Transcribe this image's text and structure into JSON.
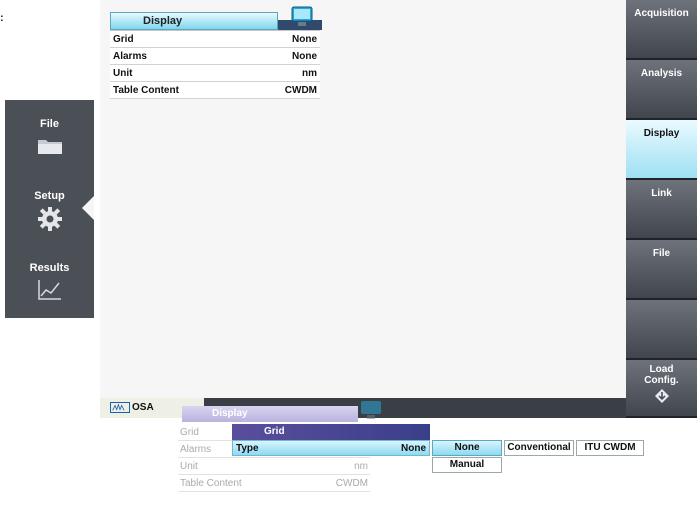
{
  "corner_mark": ":",
  "display_panel": {
    "title": "Display",
    "rows": [
      {
        "label": "Grid",
        "value": "None"
      },
      {
        "label": "Alarms",
        "value": "None"
      },
      {
        "label": "Unit",
        "value": "nm"
      },
      {
        "label": "Table Content",
        "value": "CWDM"
      }
    ]
  },
  "left_menu": {
    "items": [
      {
        "label": "File",
        "icon": "folder-icon"
      },
      {
        "label": "Setup",
        "icon": "gear-icon"
      },
      {
        "label": "Results",
        "icon": "chart-icon"
      }
    ],
    "active": "Setup"
  },
  "softkeys": {
    "items": [
      {
        "label": "Acquisition"
      },
      {
        "label": "Analysis"
      },
      {
        "label": "Display",
        "active": true
      },
      {
        "label": "Link"
      },
      {
        "label": "File"
      },
      {
        "label": ""
      },
      {
        "label": "Load Config.",
        "icon": "load-config-icon"
      }
    ]
  },
  "status_bar": {
    "tab_label": "OSA",
    "tab_icon": "osa-waveform-icon"
  },
  "bottom_snapshot": {
    "title": "Display",
    "rows": [
      {
        "label": "Grid",
        "value": ""
      },
      {
        "label": "Alarms",
        "value": ""
      },
      {
        "label": "Unit",
        "value": "nm"
      },
      {
        "label": "Table Content",
        "value": "CWDM"
      }
    ],
    "grid_menu_title": "Grid",
    "type_row": {
      "label": "Type",
      "value": "None"
    },
    "options": [
      "None",
      "Conventional",
      "ITU CWDM"
    ],
    "sub_options": [
      "Manual"
    ],
    "selected_option": "None"
  },
  "colors": {
    "highlight": "#8fd9f0",
    "panel_dark": "#4b4f56",
    "softkey_dark": "#41464e",
    "screen_bg": "#f6f6f6"
  }
}
